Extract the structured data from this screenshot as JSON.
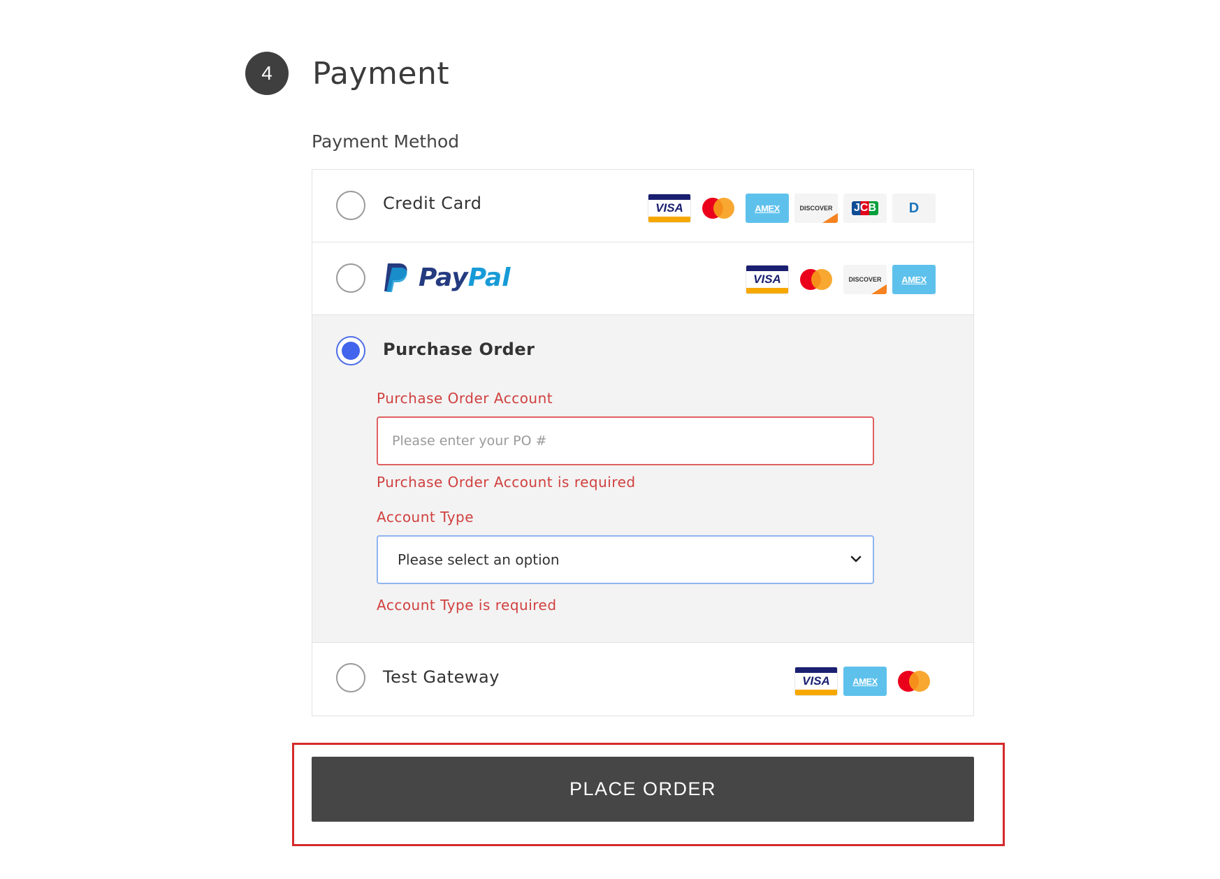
{
  "step": {
    "number": "4",
    "title": "Payment"
  },
  "payment_method_label": "Payment Method",
  "methods": {
    "credit_card": {
      "label": "Credit Card",
      "cards": [
        "VISA",
        "mastercard",
        "AMEX",
        "DISCOVER",
        "JCB",
        "diners"
      ]
    },
    "paypal": {
      "logo_pay": "Pay",
      "logo_pal": "Pal",
      "cards": [
        "VISA",
        "mastercard",
        "DISCOVER",
        "AMEX"
      ]
    },
    "purchase_order": {
      "label": "Purchase Order",
      "selected": true,
      "account_label": "Purchase Order Account",
      "account_placeholder": "Please enter your PO #",
      "account_error": "Purchase Order Account is required",
      "type_label": "Account Type",
      "type_value": "Please select an option",
      "type_error": "Account Type is required"
    },
    "test_gateway": {
      "label": "Test Gateway",
      "cards": [
        "VISA",
        "AMEX",
        "mastercard"
      ]
    }
  },
  "card_text": {
    "visa": "VISA",
    "amex": "AMEX",
    "discover": "DISCOVER",
    "jcb": "JCB",
    "diners": "D"
  },
  "place_order_label": "PLACE ORDER",
  "colors": {
    "error": "#d0403f",
    "radio_selected": "#4263eb",
    "button": "#464646",
    "highlight_frame": "#d42a2a"
  }
}
